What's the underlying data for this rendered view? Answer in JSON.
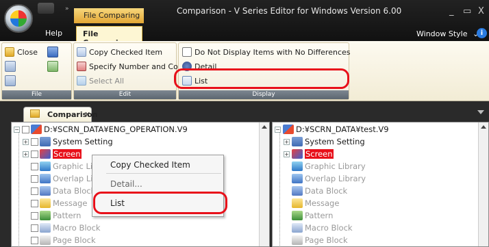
{
  "window": {
    "title": "Comparison - V Series Editor for Windows Version 6.00",
    "context_tab_top": "File Comparing",
    "controls": [
      "_",
      "▭",
      "X"
    ]
  },
  "ribbon_tabs": {
    "help": "Help",
    "file_comparing": "File Comparing",
    "window_style": "Window Style",
    "window_style_arrow": "⌄",
    "info": "i"
  },
  "ribbon": {
    "file_group": {
      "label": "File",
      "close": "Close"
    },
    "edit_group": {
      "label": "Edit",
      "copy_checked_item": "Copy Checked Item",
      "specify_number_and_copy": "Specify Number and Copy",
      "select_all": "Select All"
    },
    "display_group": {
      "label": "Display",
      "do_not_display": "Do Not Display Items with No Differences",
      "detail": "Detail",
      "list": "List"
    }
  },
  "document_tab": {
    "label": "Comparison",
    "close": "×"
  },
  "left_tree": {
    "root": "D:¥SCRN_DATA¥ENG_OPERATION.V9",
    "items": [
      {
        "label": "System Setting",
        "icon": "system-setting-icon",
        "state": "normal"
      },
      {
        "label": "Screen",
        "icon": "screen-icon",
        "state": "highlight"
      },
      {
        "label": "Graphic Library",
        "icon": "graphic-library-icon",
        "state": "dim"
      },
      {
        "label": "Overlap Library",
        "icon": "overlap-library-icon",
        "state": "dim"
      },
      {
        "label": "Data Block",
        "icon": "data-block-icon",
        "state": "dim"
      },
      {
        "label": "Message",
        "icon": "message-icon",
        "state": "dim"
      },
      {
        "label": "Pattern",
        "icon": "pattern-icon",
        "state": "dim"
      },
      {
        "label": "Macro Block",
        "icon": "macro-block-icon",
        "state": "dim"
      },
      {
        "label": "Page Block",
        "icon": "page-block-icon",
        "state": "dim"
      }
    ]
  },
  "right_tree": {
    "root": "D:¥SCRN_DATA¥test.V9",
    "items": [
      {
        "label": "System Setting",
        "icon": "system-setting-icon",
        "state": "normal"
      },
      {
        "label": "Screen",
        "icon": "screen-icon",
        "state": "highlight"
      },
      {
        "label": "Graphic Library",
        "icon": "graphic-library-icon",
        "state": "dim"
      },
      {
        "label": "Overlap Library",
        "icon": "overlap-library-icon",
        "state": "dim"
      },
      {
        "label": "Data Block",
        "icon": "data-block-icon",
        "state": "dim"
      },
      {
        "label": "Message",
        "icon": "message-icon",
        "state": "dim"
      },
      {
        "label": "Pattern",
        "icon": "pattern-icon",
        "state": "dim"
      },
      {
        "label": "Macro Block",
        "icon": "macro-block-icon",
        "state": "dim"
      },
      {
        "label": "Page Block",
        "icon": "page-block-icon",
        "state": "dim"
      }
    ]
  },
  "context_menu": {
    "items": [
      "Copy Checked Item",
      "Detail...",
      "List"
    ]
  },
  "colors": {
    "accent_highlight": "#e8101a",
    "context_tab": "#e3a634",
    "title_bar": "#111111"
  }
}
